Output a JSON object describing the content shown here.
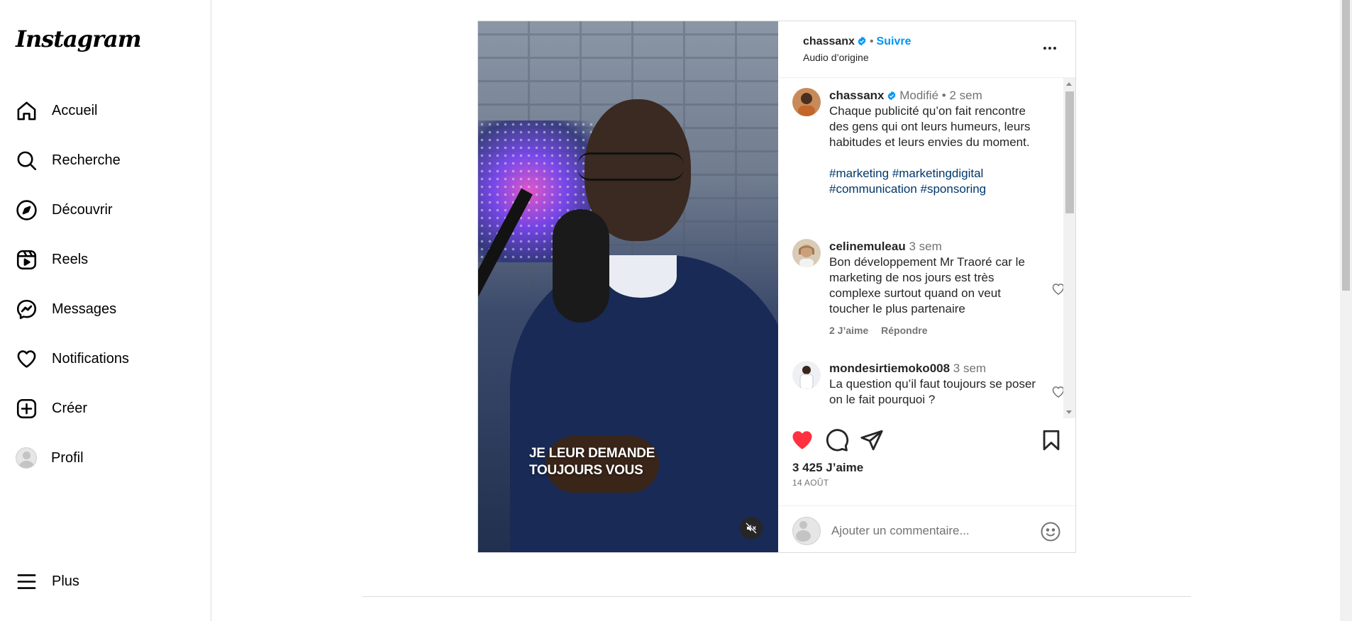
{
  "sidebar": {
    "logo": "Instagram",
    "items": [
      {
        "label": "Accueil",
        "icon": "home-icon"
      },
      {
        "label": "Recherche",
        "icon": "search-icon"
      },
      {
        "label": "Découvrir",
        "icon": "compass-icon"
      },
      {
        "label": "Reels",
        "icon": "reels-icon"
      },
      {
        "label": "Messages",
        "icon": "messenger-icon"
      },
      {
        "label": "Notifications",
        "icon": "heart-icon"
      },
      {
        "label": "Créer",
        "icon": "plus-square-icon"
      },
      {
        "label": "Profil",
        "icon": "avatar"
      }
    ],
    "more_label": "Plus"
  },
  "post": {
    "overlay_line1": "JE LEUR DEMANDE",
    "overlay_line2": "TOUJOURS VOUS",
    "header": {
      "username": "chassanx",
      "separator": "•",
      "follow": "Suivre",
      "audio": "Audio d’origine"
    },
    "caption": {
      "username": "chassanx",
      "edited": "Modifié",
      "separator": "•",
      "time": "2 sem",
      "text": "Chaque publicité qu’on fait rencontre des gens qui ont leurs humeurs, leurs habitudes et leurs envies du moment.",
      "hashtags": "#marketing #marketingdigital #communication #sponsoring"
    },
    "comments": [
      {
        "username": "celinemuleau",
        "time": "3 sem",
        "text": "Bon développement Mr Traoré car le marketing de nos jours est très complexe surtout quand on veut toucher le plus partenaire",
        "likes": "2 J’aime",
        "reply": "Répondre"
      },
      {
        "username": "mondesirtiemoko008",
        "time": "3 sem",
        "text": "La question qu’il faut toujours se poser on le fait pourquoi ?"
      }
    ],
    "likes": "3 425 J’aime",
    "date": "14 AOÛT",
    "add_comment_placeholder": "Ajouter un commentaire...",
    "liked": true
  },
  "colors": {
    "accent": "#0095f6",
    "like": "#ff3040",
    "hashtag": "#00376b",
    "secondary_text": "#737373",
    "border": "#dbdbdb"
  }
}
